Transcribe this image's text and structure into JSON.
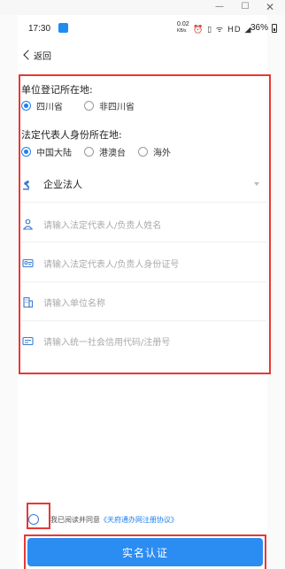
{
  "window": {
    "min_glyph": "—",
    "max_glyph": "☐",
    "close_glyph": "✕"
  },
  "status_bar": {
    "time": "17:30",
    "net_speed": "0.02",
    "net_unit": "KB/s",
    "icons": "⏰ ▯ ᯤ HD ◢",
    "battery": "36%"
  },
  "nav": {
    "back_label": "返回"
  },
  "form": {
    "reg_location_label": "单位登记所在地:",
    "reg_location_options": [
      "四川省",
      "非四川省"
    ],
    "reg_location_selected": "四川省",
    "rep_id_label": "法定代表人身份所在地:",
    "rep_id_options": [
      "中国大陆",
      "港澳台",
      "海外"
    ],
    "rep_id_selected": "中国大陆",
    "entity_type": "企业法人",
    "rep_name_placeholder": "请输入法定代表人/负责人姓名",
    "rep_idno_placeholder": "请输入法定代表人/负责人身份证号",
    "unit_name_placeholder": "请输入单位名称",
    "credit_code_placeholder": "请输入统一社会信用代码/注册号"
  },
  "agreement": {
    "text": "我已阅读并同意",
    "link": "《天府通办网注册协议》",
    "checked": false
  },
  "submit_label": "实名认证",
  "colors": {
    "accent": "#1e7ff0",
    "button": "#2b8cf2",
    "highlight": "#e53935"
  }
}
